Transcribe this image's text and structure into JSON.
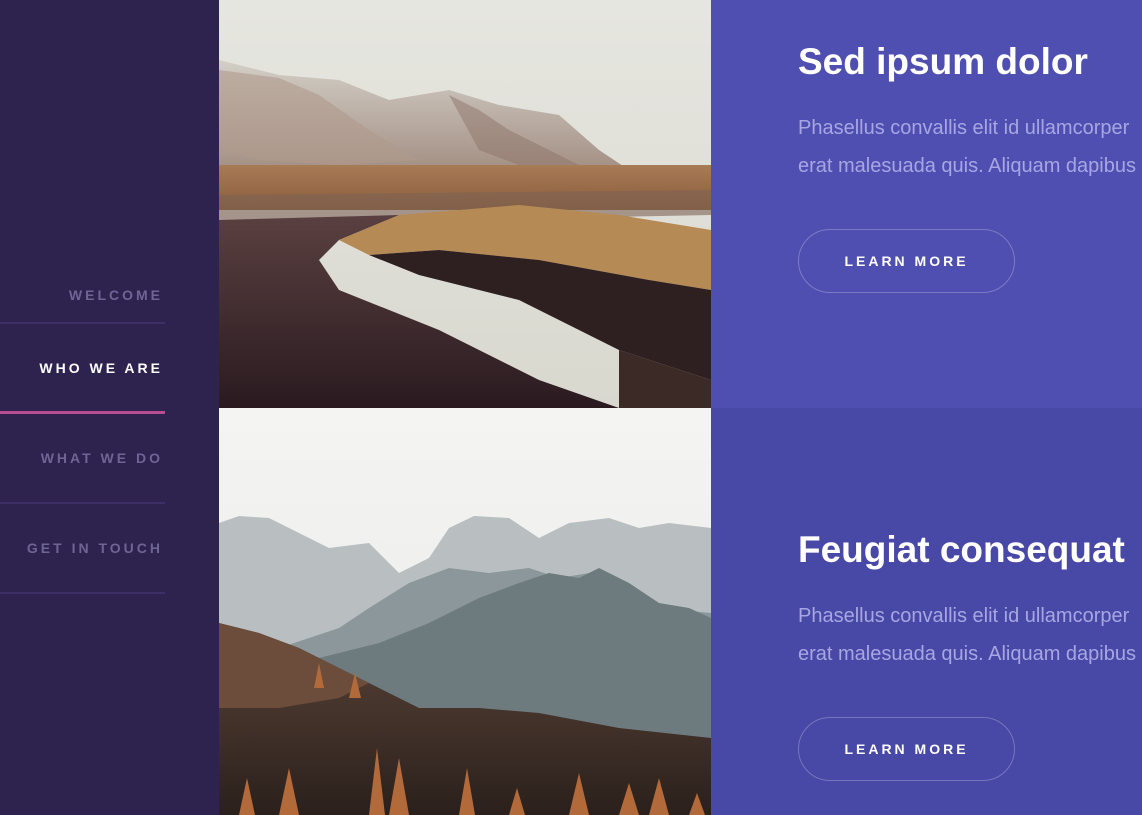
{
  "nav": {
    "items": [
      {
        "label": "WELCOME",
        "active": false
      },
      {
        "label": "WHO WE ARE",
        "active": true
      },
      {
        "label": "WHAT WE DO",
        "active": false
      },
      {
        "label": "GET IN TOUCH",
        "active": false
      }
    ]
  },
  "sections": [
    {
      "title": "Sed ipsum dolor",
      "desc_line1": "Phasellus convallis elit id ullamcorper",
      "desc_line2": "erat malesuada quis. Aliquam dapibus",
      "button": "LEARN MORE",
      "image": "foggy-mountain-river-landscape"
    },
    {
      "title": "Feugiat consequat",
      "desc_line1": "Phasellus convallis elit id ullamcorper",
      "desc_line2": "erat malesuada quis. Aliquam dapibus",
      "button": "LEARN MORE",
      "image": "misty-mountain-ridges-autumn-forest"
    }
  ],
  "colors": {
    "sidebar": "#2e224f",
    "row1": "#4f4fb2",
    "row2": "#4848a6",
    "active_underline": "#b74e91"
  }
}
